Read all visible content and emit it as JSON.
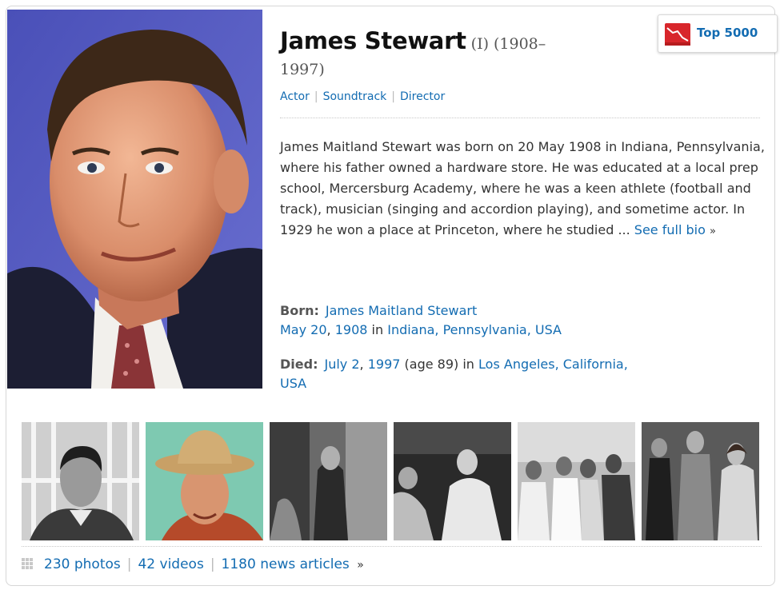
{
  "person": {
    "name": "James Stewart",
    "disambiguation": "(I)",
    "years_start": "(1908–",
    "years_end": "1997)"
  },
  "roles": [
    "Actor",
    "Soundtrack",
    "Director"
  ],
  "badge": {
    "label": "Top 5000",
    "icon": "starmeter-chart-icon"
  },
  "bio": {
    "text": "James Maitland Stewart was born on 20 May 1908 in Indiana, Pennsylvania, where his father owned a hardware store. He was educated at a local prep school, Mercersburg Academy, where he was a keen athlete (football and track), musician (singing and accordion playing), and sometime actor. In 1929 he won a place at Princeton, where he studied ...",
    "see_more": "See full bio",
    "see_more_arrow": "»"
  },
  "born": {
    "label": "Born:",
    "birth_name": "James Maitland Stewart",
    "date_md": "May 20",
    "comma": ",",
    "year": "1908",
    "in": "in",
    "place": "Indiana, Pennsylvania, USA"
  },
  "died": {
    "label": "Died:",
    "date_md": "July 2",
    "comma": ",",
    "year": "1997",
    "age": "(age 89)",
    "in": "in",
    "place": "Los Angeles, California,",
    "place2": "USA"
  },
  "media": {
    "photos": "230 photos",
    "videos": "42 videos",
    "news": "1180 news articles",
    "arrow": "»",
    "separator": "|",
    "icon": "grid-icon"
  },
  "thumbnails": [
    {
      "alt": "photo-1"
    },
    {
      "alt": "photo-2"
    },
    {
      "alt": "photo-3"
    },
    {
      "alt": "photo-4"
    },
    {
      "alt": "photo-5"
    },
    {
      "alt": "photo-6"
    }
  ],
  "colors": {
    "link": "#136cb2",
    "text": "#333333",
    "heading": "#111111",
    "badge_icon": "#d8262b"
  }
}
